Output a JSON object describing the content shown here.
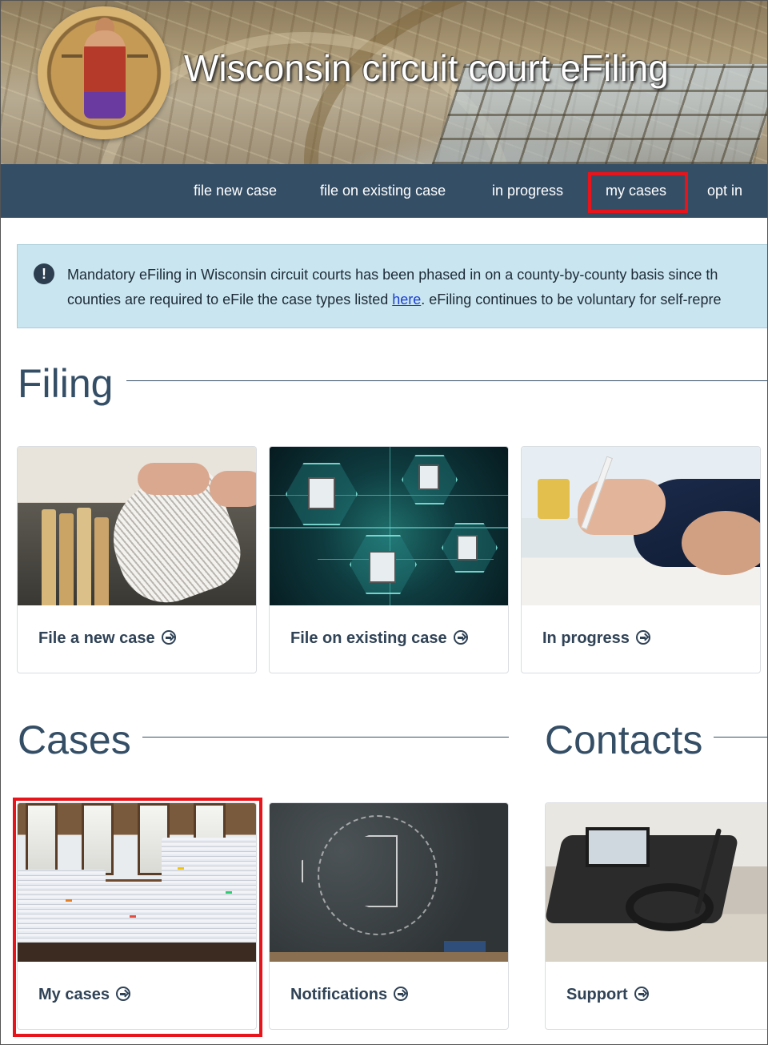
{
  "header": {
    "site_title": "Wisconsin circuit court eFiling",
    "logo": "wisconsin-court-seal"
  },
  "nav": {
    "items": [
      {
        "label": "file new case"
      },
      {
        "label": "file on existing case"
      },
      {
        "label": "in progress"
      },
      {
        "label": "my cases",
        "highlighted": true
      },
      {
        "label": "opt in"
      }
    ]
  },
  "alert": {
    "icon": "exclamation-circle-icon",
    "line1": "Mandatory eFiling in Wisconsin circuit courts has been phased in on a county-by-county basis since th",
    "line2_before": "counties are required to eFile the case types listed ",
    "line2_link": "here",
    "line2_after": ". eFiling continues to be voluntary for self-repre"
  },
  "sections": {
    "filing": {
      "title": "Filing",
      "cards": [
        {
          "label": "File a new case",
          "icon": "arrow-circle-right-icon"
        },
        {
          "label": "File on existing case",
          "icon": "arrow-circle-right-icon"
        },
        {
          "label": "In progress",
          "icon": "arrow-circle-right-icon"
        }
      ]
    },
    "cases": {
      "title": "Cases",
      "cards": [
        {
          "label": "My cases",
          "icon": "arrow-circle-right-icon",
          "highlighted": true
        },
        {
          "label": "Notifications",
          "icon": "arrow-circle-right-icon"
        }
      ]
    },
    "contacts": {
      "title": "Contacts",
      "cards": [
        {
          "label": "Support",
          "icon": "arrow-circle-right-icon"
        }
      ]
    }
  },
  "colors": {
    "nav_bg": "#344e66",
    "alert_bg": "#c9e5ef",
    "highlight": "#e8141b",
    "heading": "#344e66"
  }
}
